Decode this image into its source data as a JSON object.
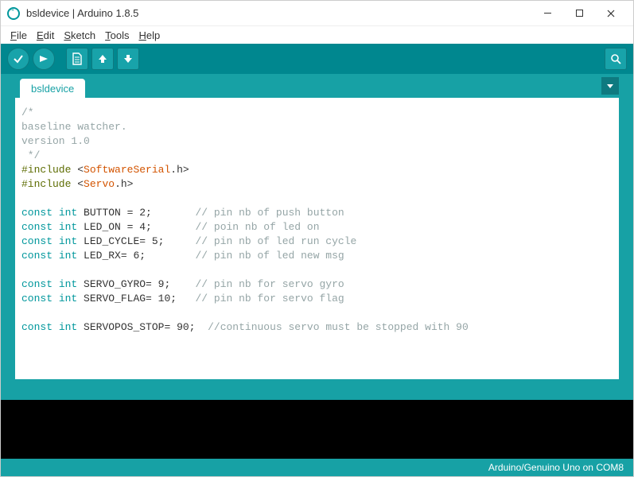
{
  "window": {
    "title": "bsldevice | Arduino 1.8.5"
  },
  "menubar": {
    "file": "File",
    "edit": "Edit",
    "sketch": "Sketch",
    "tools": "Tools",
    "help": "Help"
  },
  "tab": {
    "name": "bsldevice"
  },
  "code": {
    "l01": "/*",
    "l02": "baseline watcher.",
    "l03": "version 1.0",
    "l04": " */",
    "l05a": "#include",
    "l05b": "<",
    "l05c": "SoftwareSerial",
    "l05d": ".h>",
    "l06a": "#include",
    "l06b": "<",
    "l06c": "Servo",
    "l06d": ".h>",
    "l08a": "const",
    "l08b": "int",
    "l08c": "BUTTON = 2;",
    "l08d": "// pin nb of push button",
    "l09a": "const",
    "l09b": "int",
    "l09c": "LED_ON = 4;",
    "l09d": "// poin nb of led on",
    "l10a": "const",
    "l10b": "int",
    "l10c": "LED_CYCLE= 5;",
    "l10d": "// pin nb of led run cycle",
    "l11a": "const",
    "l11b": "int",
    "l11c": "LED_RX= 6;",
    "l11d": "// pin nb of led new msg",
    "l13a": "const",
    "l13b": "int",
    "l13c": "SERVO_GYRO= 9;",
    "l13d": "// pin nb for servo gyro",
    "l14a": "const",
    "l14b": "int",
    "l14c": "SERVO_FLAG= 10;",
    "l14d": "// pin nb for servo flag",
    "l16a": "const",
    "l16b": "int",
    "l16c": "SERVOPOS_STOP= 90;",
    "l16d": "//continuous servo must be stopped with 90"
  },
  "footer": {
    "board": "Arduino/Genuino Uno on COM8"
  }
}
